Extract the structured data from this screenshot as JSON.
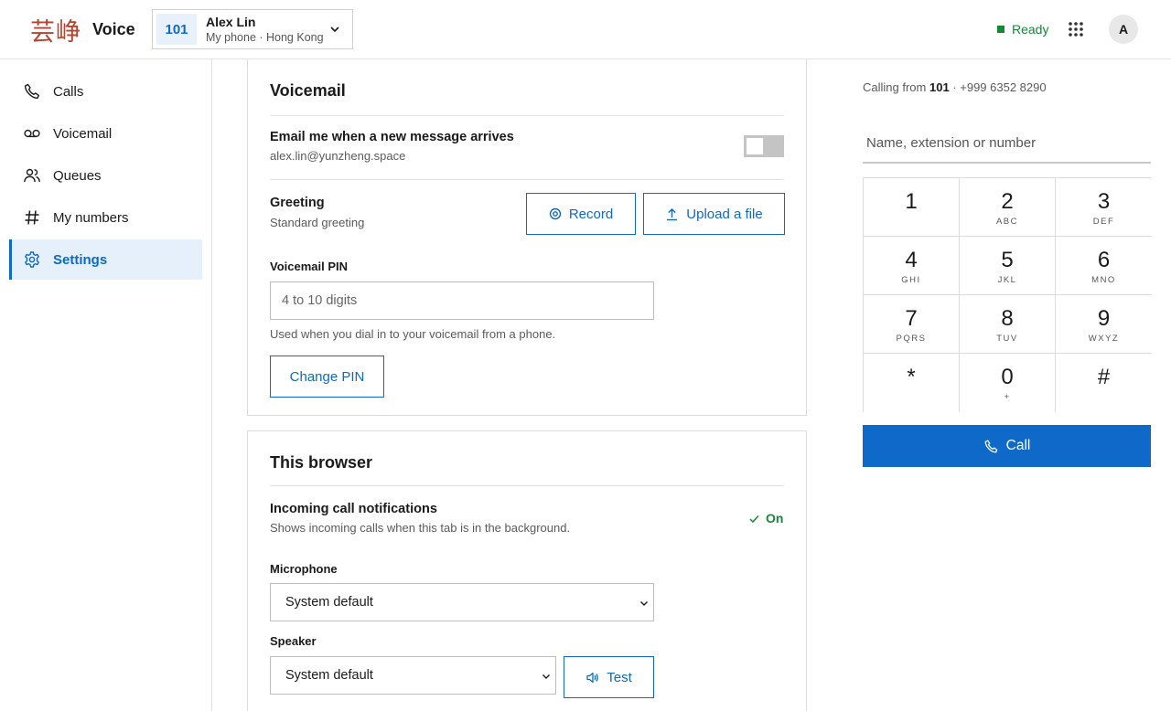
{
  "header": {
    "logo_mark": "芸峥",
    "logo_word": "Voice",
    "extension": "101",
    "user_name": "Alex Lin",
    "user_sub": "My phone · Hong Kong",
    "status": "Ready",
    "avatar_initial": "A",
    "status_color": "#138a36"
  },
  "sidebar": {
    "items": [
      {
        "label": "Calls",
        "icon": "phone-icon"
      },
      {
        "label": "Voicemail",
        "icon": "voicemail-icon"
      },
      {
        "label": "Queues",
        "icon": "users-icon"
      },
      {
        "label": "My numbers",
        "icon": "hash-icon"
      },
      {
        "label": "Settings",
        "icon": "gear-icon",
        "active": true
      }
    ]
  },
  "voicemail": {
    "title": "Voicemail",
    "email_title": "Email me when a new message arrives",
    "email_address": "alex.lin@yunzheng.space",
    "email_enabled": false,
    "greeting_title": "Greeting",
    "greeting_sub": "Standard greeting",
    "record_label": "Record",
    "upload_label": "Upload a file",
    "pin_label": "Voicemail PIN",
    "pin_value": "",
    "pin_placeholder": "4 to 10 digits",
    "pin_help": "Used when you dial in to your voicemail from a phone.",
    "change_pin_label": "Change PIN"
  },
  "browser": {
    "title": "This browser",
    "notif_title": "Incoming call notifications",
    "notif_sub": "Shows incoming calls when this tab is in the background.",
    "notif_state": "On",
    "mic_label": "Microphone",
    "mic_value": "System default",
    "speaker_label": "Speaker",
    "speaker_value": "System default",
    "test_label": "Test"
  },
  "dialer": {
    "calling_from_prefix": "Calling from",
    "calling_from_ext": "101",
    "calling_from_number": "· +999 6352 8290",
    "input_value": "",
    "input_placeholder": "Name, extension or number",
    "keys": [
      {
        "digit": "1",
        "letters": ""
      },
      {
        "digit": "2",
        "letters": "ABC"
      },
      {
        "digit": "3",
        "letters": "DEF"
      },
      {
        "digit": "4",
        "letters": "GHI"
      },
      {
        "digit": "5",
        "letters": "JKL"
      },
      {
        "digit": "6",
        "letters": "MNO"
      },
      {
        "digit": "7",
        "letters": "PQRS"
      },
      {
        "digit": "8",
        "letters": "TUV"
      },
      {
        "digit": "9",
        "letters": "WXYZ"
      },
      {
        "digit": "*",
        "letters": ""
      },
      {
        "digit": "0",
        "letters": "+"
      },
      {
        "digit": "#",
        "letters": ""
      }
    ],
    "call_label": "Call"
  },
  "theme": {
    "accent": "#0f69c9",
    "brand": "#b5432e"
  }
}
